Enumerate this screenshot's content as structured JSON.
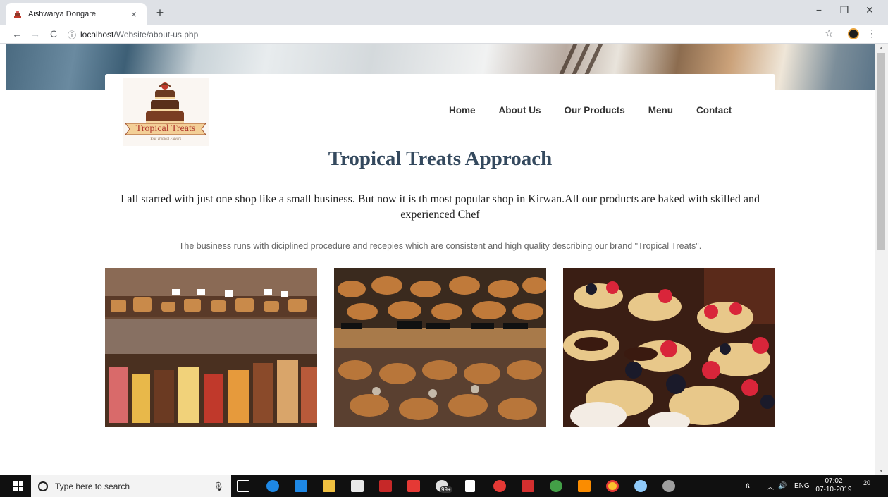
{
  "browser": {
    "tab_title": "Aishwarya Dongare",
    "tab_close": "×",
    "new_tab": "+",
    "url_host": "localhost",
    "url_path": "/Website/about-us.php",
    "minimize": "−",
    "restore": "❐",
    "close": "✕",
    "back": "←",
    "forward": "→",
    "reload": "C",
    "info_icon": "ⓘ",
    "star": "☆",
    "menu": "⋮"
  },
  "site": {
    "logo_text": "Tropical Treats",
    "logo_tagline": "Your Tropical Flavors",
    "nav": [
      "Home",
      "About Us",
      "Our Products",
      "Menu",
      "Contact"
    ],
    "heading": "Tropical Treats Approach",
    "intro": "I all started with just one shop like a small business. But now it is th most popular shop in Kirwan.All our products are baked with skilled and experienced Chef",
    "sub": "The business runs with diciplined procedure and recepies which are consistent and high quality describing our brand \"Tropical Treats\"."
  },
  "taskbar": {
    "search_placeholder": "Type here to search",
    "tray_lang": "ENG",
    "time": "07:02",
    "date": "07-10-2019",
    "badge": "99+",
    "notif_count": "20"
  },
  "colors": {
    "heading": "#34495e",
    "nav_text": "#333333",
    "tab_bar": "#dee1e6",
    "taskbar": "#101010"
  }
}
